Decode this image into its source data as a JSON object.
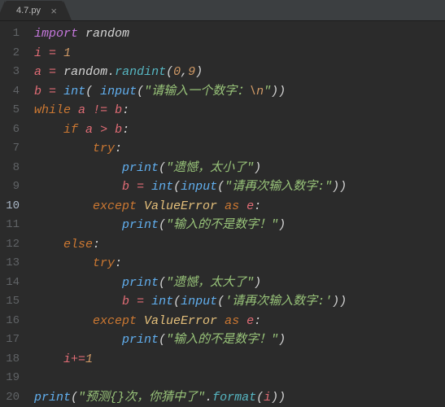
{
  "tab": {
    "filename": "4.7.py",
    "close_glyph": "×"
  },
  "gutter": {
    "start": 1,
    "end": 20,
    "current": 10
  },
  "code": {
    "lines": [
      [
        {
          "c": "kwr",
          "t": "import"
        },
        {
          "c": "pun",
          "t": " "
        },
        {
          "c": "name",
          "t": "random"
        }
      ],
      [
        {
          "c": "var",
          "t": "i"
        },
        {
          "c": "pun",
          "t": " "
        },
        {
          "c": "opr",
          "t": "="
        },
        {
          "c": "pun",
          "t": " "
        },
        {
          "c": "num",
          "t": "1"
        }
      ],
      [
        {
          "c": "var",
          "t": "a"
        },
        {
          "c": "pun",
          "t": " "
        },
        {
          "c": "opr",
          "t": "="
        },
        {
          "c": "pun",
          "t": " "
        },
        {
          "c": "name",
          "t": "random"
        },
        {
          "c": "pun",
          "t": "."
        },
        {
          "c": "call",
          "t": "randint"
        },
        {
          "c": "pun",
          "t": "("
        },
        {
          "c": "num",
          "t": "0"
        },
        {
          "c": "pun",
          "t": ","
        },
        {
          "c": "num",
          "t": "9"
        },
        {
          "c": "pun",
          "t": ")"
        }
      ],
      [
        {
          "c": "var",
          "t": "b"
        },
        {
          "c": "pun",
          "t": " "
        },
        {
          "c": "opr",
          "t": "="
        },
        {
          "c": "pun",
          "t": " "
        },
        {
          "c": "func",
          "t": "int"
        },
        {
          "c": "pun",
          "t": "( "
        },
        {
          "c": "func",
          "t": "input"
        },
        {
          "c": "pun",
          "t": "("
        },
        {
          "c": "str",
          "t": "\"请输入一个数字："
        },
        {
          "c": "esc",
          "t": "\\n"
        },
        {
          "c": "str",
          "t": "\""
        },
        {
          "c": "pun",
          "t": "))"
        }
      ],
      [
        {
          "c": "kw",
          "t": "while"
        },
        {
          "c": "pun",
          "t": " "
        },
        {
          "c": "var",
          "t": "a"
        },
        {
          "c": "pun",
          "t": " "
        },
        {
          "c": "opr",
          "t": "!="
        },
        {
          "c": "pun",
          "t": " "
        },
        {
          "c": "var",
          "t": "b"
        },
        {
          "c": "pun",
          "t": ":"
        }
      ],
      [
        {
          "c": "pun",
          "t": "    "
        },
        {
          "c": "kw",
          "t": "if"
        },
        {
          "c": "pun",
          "t": " "
        },
        {
          "c": "var",
          "t": "a"
        },
        {
          "c": "pun",
          "t": " "
        },
        {
          "c": "opr",
          "t": ">"
        },
        {
          "c": "pun",
          "t": " "
        },
        {
          "c": "var",
          "t": "b"
        },
        {
          "c": "pun",
          "t": ":"
        }
      ],
      [
        {
          "c": "pun",
          "t": "        "
        },
        {
          "c": "kw",
          "t": "try"
        },
        {
          "c": "pun",
          "t": ":"
        }
      ],
      [
        {
          "c": "pun",
          "t": "            "
        },
        {
          "c": "func",
          "t": "print"
        },
        {
          "c": "pun",
          "t": "("
        },
        {
          "c": "str",
          "t": "\"遗憾，太小了\""
        },
        {
          "c": "pun",
          "t": ")"
        }
      ],
      [
        {
          "c": "pun",
          "t": "            "
        },
        {
          "c": "var",
          "t": "b"
        },
        {
          "c": "pun",
          "t": " "
        },
        {
          "c": "opr",
          "t": "="
        },
        {
          "c": "pun",
          "t": " "
        },
        {
          "c": "func",
          "t": "int"
        },
        {
          "c": "pun",
          "t": "("
        },
        {
          "c": "func",
          "t": "input"
        },
        {
          "c": "pun",
          "t": "("
        },
        {
          "c": "str",
          "t": "\"请再次输入数字:\""
        },
        {
          "c": "pun",
          "t": "))"
        }
      ],
      [
        {
          "c": "pun",
          "t": "        "
        },
        {
          "c": "kw",
          "t": "except"
        },
        {
          "c": "pun",
          "t": " "
        },
        {
          "c": "cls",
          "t": "ValueError"
        },
        {
          "c": "pun",
          "t": " "
        },
        {
          "c": "kw",
          "t": "as"
        },
        {
          "c": "pun",
          "t": " "
        },
        {
          "c": "var",
          "t": "e"
        },
        {
          "c": "pun",
          "t": ":"
        }
      ],
      [
        {
          "c": "pun",
          "t": "            "
        },
        {
          "c": "func",
          "t": "print"
        },
        {
          "c": "pun",
          "t": "("
        },
        {
          "c": "str",
          "t": "\"输入的不是数字！\""
        },
        {
          "c": "pun",
          "t": ")"
        }
      ],
      [
        {
          "c": "pun",
          "t": "    "
        },
        {
          "c": "kw",
          "t": "else"
        },
        {
          "c": "pun",
          "t": ":"
        }
      ],
      [
        {
          "c": "pun",
          "t": "        "
        },
        {
          "c": "kw",
          "t": "try"
        },
        {
          "c": "pun",
          "t": ":"
        }
      ],
      [
        {
          "c": "pun",
          "t": "            "
        },
        {
          "c": "func",
          "t": "print"
        },
        {
          "c": "pun",
          "t": "("
        },
        {
          "c": "str",
          "t": "\"遗憾，太大了\""
        },
        {
          "c": "pun",
          "t": ")"
        }
      ],
      [
        {
          "c": "pun",
          "t": "            "
        },
        {
          "c": "var",
          "t": "b"
        },
        {
          "c": "pun",
          "t": " "
        },
        {
          "c": "opr",
          "t": "="
        },
        {
          "c": "pun",
          "t": " "
        },
        {
          "c": "func",
          "t": "int"
        },
        {
          "c": "pun",
          "t": "("
        },
        {
          "c": "func",
          "t": "input"
        },
        {
          "c": "pun",
          "t": "("
        },
        {
          "c": "str",
          "t": "'请再次输入数字:'"
        },
        {
          "c": "pun",
          "t": "))"
        }
      ],
      [
        {
          "c": "pun",
          "t": "        "
        },
        {
          "c": "kw",
          "t": "except"
        },
        {
          "c": "pun",
          "t": " "
        },
        {
          "c": "cls",
          "t": "ValueError"
        },
        {
          "c": "pun",
          "t": " "
        },
        {
          "c": "kw",
          "t": "as"
        },
        {
          "c": "pun",
          "t": " "
        },
        {
          "c": "var",
          "t": "e"
        },
        {
          "c": "pun",
          "t": ":"
        }
      ],
      [
        {
          "c": "pun",
          "t": "            "
        },
        {
          "c": "func",
          "t": "print"
        },
        {
          "c": "pun",
          "t": "("
        },
        {
          "c": "str",
          "t": "\"输入的不是数字！\""
        },
        {
          "c": "pun",
          "t": ")"
        }
      ],
      [
        {
          "c": "pun",
          "t": "    "
        },
        {
          "c": "var",
          "t": "i"
        },
        {
          "c": "opr",
          "t": "+="
        },
        {
          "c": "num",
          "t": "1"
        }
      ],
      [],
      [
        {
          "c": "func",
          "t": "print"
        },
        {
          "c": "pun",
          "t": "("
        },
        {
          "c": "str",
          "t": "\"预测{}次，你猜中了\""
        },
        {
          "c": "pun",
          "t": "."
        },
        {
          "c": "call",
          "t": "format"
        },
        {
          "c": "pun",
          "t": "("
        },
        {
          "c": "var",
          "t": "i"
        },
        {
          "c": "pun",
          "t": "))"
        }
      ]
    ]
  }
}
